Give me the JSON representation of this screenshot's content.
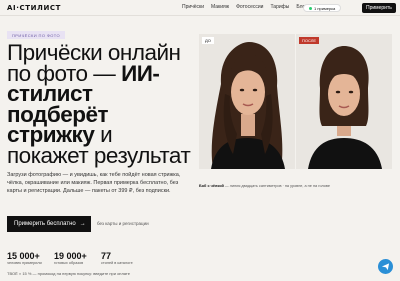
{
  "header": {
    "logo": "AI·СТИЛИСТ",
    "nav": [
      "Причёски",
      "Макияж",
      "Фотосессии",
      "Тарифы",
      "Блог"
    ],
    "badge": "1 примерка",
    "cta": "Примерить"
  },
  "hero": {
    "tag": "ПРИЧЁСКИ ПО ФОТО",
    "title_part1": "Причёски онлайн по фото — ",
    "title_bold": "ИИ-стилист подберёт стрижку",
    "title_part2": " и покажет результат",
    "description": "Загрузи фотографию — и увидишь, как тебе пойдёт новая стрижка, чёлка, окрашивание или макияж. Первая примерка бесплатно, без карты и регистрации. Дальше — пакеты от 399 ₽, без подписки.",
    "cta_label": "Примерить бесплатно",
    "cta_arrow": "→",
    "cta_note": "без карты и регистрации"
  },
  "stats": [
    {
      "num": "15 000+",
      "label": "человек примерили"
    },
    {
      "num": "19 000+",
      "label": "готовых образов"
    },
    {
      "num": "77",
      "label": "стилей в каталоге"
    }
  ],
  "footnote": "ТВОЁ × 15 %  — промокод на первую покупку: введите при оплате",
  "photos": {
    "before_label": "ДО",
    "after_label": "ПОСЛЕ"
  },
  "caption": {
    "bold": "Боб с чёлкой",
    "rest": " — линия двадцать сантиметров · на уровне, а не на голове"
  },
  "colors": {
    "accent": "#111111",
    "tag_bg": "#e8e2f3",
    "after_label": "#c0392b",
    "chat": "#2a8fd6"
  }
}
